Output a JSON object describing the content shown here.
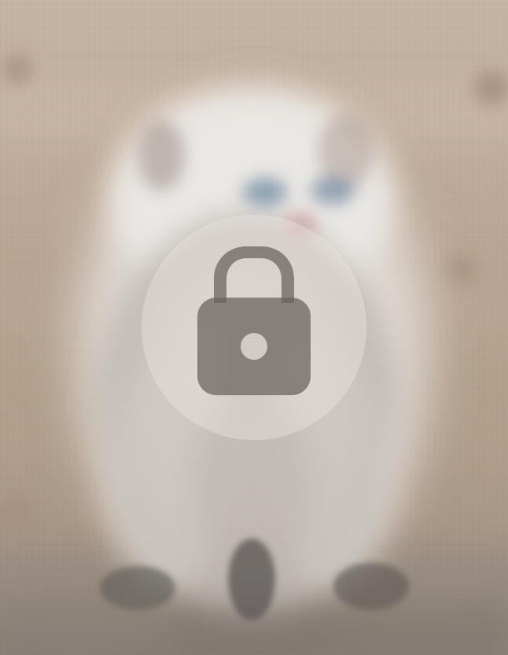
{
  "image": {
    "kind": "blurred-photo-preview",
    "palette": {
      "background": "#b8a594",
      "fur": "#e9e8e6",
      "shadow": "#756f67",
      "accent_blue": "#7d92a8",
      "accent_pink": "#c7979a"
    }
  },
  "overlay": {
    "state": "locked",
    "icon": "lock-icon",
    "badge_color": "#ece5e0",
    "icon_color": "#68615d"
  }
}
